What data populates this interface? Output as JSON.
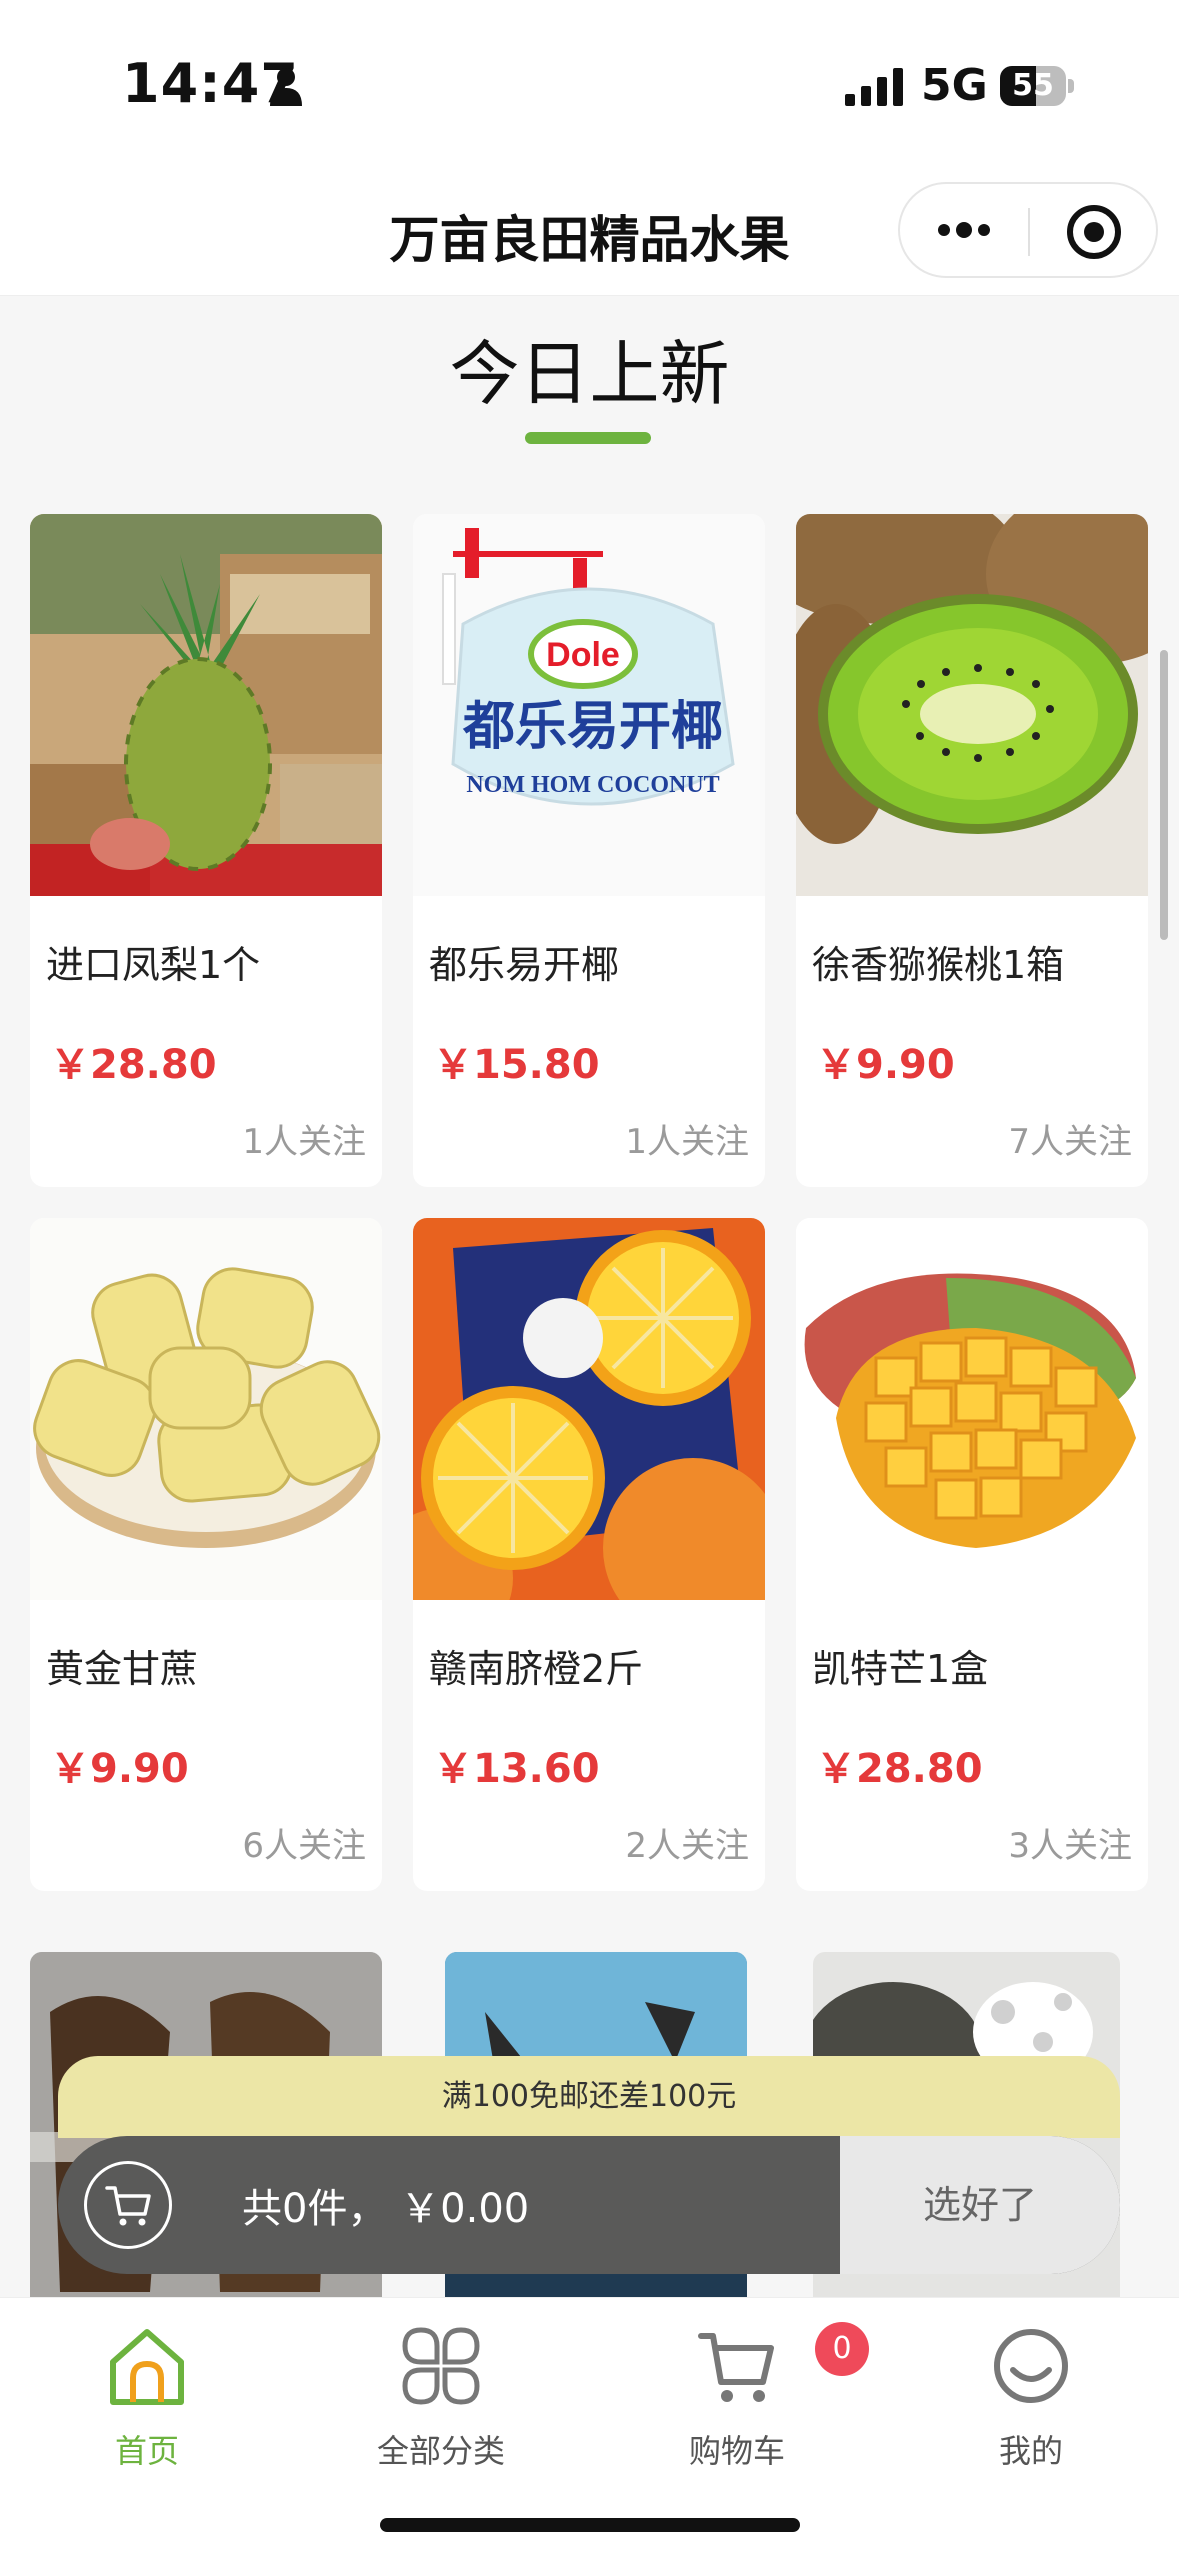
{
  "status_bar": {
    "time": "14:47",
    "network": "5G",
    "battery": "55",
    "battery_level": 0.55
  },
  "nav": {
    "title": "万亩良田精品水果"
  },
  "section": {
    "title": "今日上新"
  },
  "products": [
    {
      "name": "进口凤梨1个",
      "price": "￥28.80",
      "followers": "1人关注",
      "image": "pineapple"
    },
    {
      "name": "都乐易开椰",
      "price": "￥15.80",
      "followers": "1人关注",
      "image": "coconut"
    },
    {
      "name": "徐香猕猴桃1箱",
      "price": "￥9.90",
      "followers": "7人关注",
      "image": "kiwi"
    },
    {
      "name": "黄金甘蔗",
      "price": "￥9.90",
      "followers": "6人关注",
      "image": "sugarcane"
    },
    {
      "name": "赣南脐橙2斤",
      "price": "￥13.60",
      "followers": "2人关注",
      "image": "orange"
    },
    {
      "name": "凯特芒1盒",
      "price": "￥28.80",
      "followers": "3人关注",
      "image": "mango"
    }
  ],
  "coconut_brand": {
    "logo": "Dole",
    "label": "都乐易开椰",
    "sub": "NOM HOM COCONUT"
  },
  "cart": {
    "promo": "满100免邮还差100元",
    "summary": "共0件，  ￥0.00",
    "done_label": "选好了"
  },
  "tabs": [
    {
      "label": "首页",
      "icon": "home-icon",
      "active": true
    },
    {
      "label": "全部分类",
      "icon": "category-icon",
      "active": false
    },
    {
      "label": "购物车",
      "icon": "cart-icon",
      "active": false
    },
    {
      "label": "我的",
      "icon": "profile-icon",
      "active": false
    }
  ],
  "cart_badge": "0",
  "colors": {
    "accent": "#6db33f",
    "price": "#e5393a",
    "badge": "#ef4a5a"
  }
}
